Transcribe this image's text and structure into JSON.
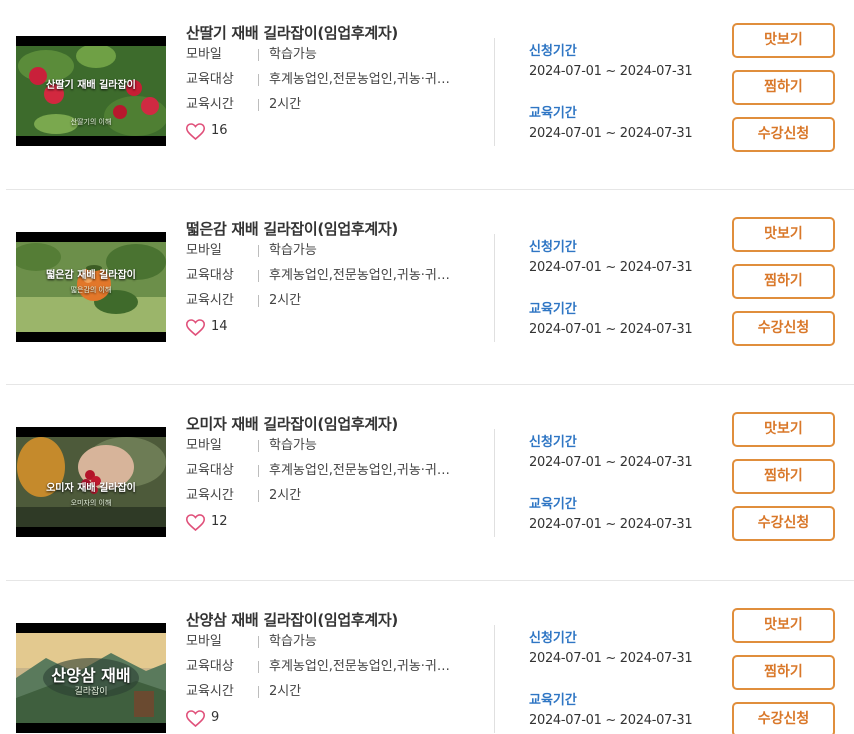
{
  "labels": {
    "device_key": "모바일",
    "target_key": "교육대상",
    "time_key": "교육시간",
    "apply_period": "신청기간",
    "edu_period": "교육기간",
    "preview_button": "맛보기",
    "wishlist_button": "찜하기",
    "enroll_button": "수강신청"
  },
  "courses": [
    {
      "title": "산딸기 재배 길라잡이(임업후계자)",
      "device": "학습가능",
      "target": "후계농업인,전문농업인,귀농·귀…",
      "time": "2시간",
      "likes": "16",
      "apply_period": "2024-07-01 ~ 2024-07-31",
      "edu_period": "2024-07-01 ~ 2024-07-31",
      "thumb_caption": "산딸기 재배 길라잡이",
      "thumb_subcaption": "산딸기의 이해"
    },
    {
      "title": "떫은감 재배 길라잡이(임업후계자)",
      "device": "학습가능",
      "target": "후계농업인,전문농업인,귀농·귀…",
      "time": "2시간",
      "likes": "14",
      "apply_period": "2024-07-01 ~ 2024-07-31",
      "edu_period": "2024-07-01 ~ 2024-07-31",
      "thumb_caption": "떫은감 재배 길라잡이",
      "thumb_subcaption": "떫은감의 이해"
    },
    {
      "title": "오미자 재배 길라잡이(임업후계자)",
      "device": "학습가능",
      "target": "후계농업인,전문농업인,귀농·귀…",
      "time": "2시간",
      "likes": "12",
      "apply_period": "2024-07-01 ~ 2024-07-31",
      "edu_period": "2024-07-01 ~ 2024-07-31",
      "thumb_caption": "오미자 재배 길라잡이",
      "thumb_subcaption": "오미자의 이해"
    },
    {
      "title": "산양삼 재배 길라잡이(임업후계자)",
      "device": "학습가능",
      "target": "후계농업인,전문농업인,귀농·귀…",
      "time": "2시간",
      "likes": "9",
      "apply_period": "2024-07-01 ~ 2024-07-31",
      "edu_period": "2024-07-01 ~ 2024-07-31",
      "thumb_caption": "산양삼 재배",
      "thumb_subcaption": "길라잡이"
    }
  ],
  "colors": {
    "accent_orange": "#e08e3c",
    "label_blue": "#2f76c4",
    "heart_pink": "#e0507a"
  },
  "icons": {
    "like": "heart-outline-icon"
  }
}
